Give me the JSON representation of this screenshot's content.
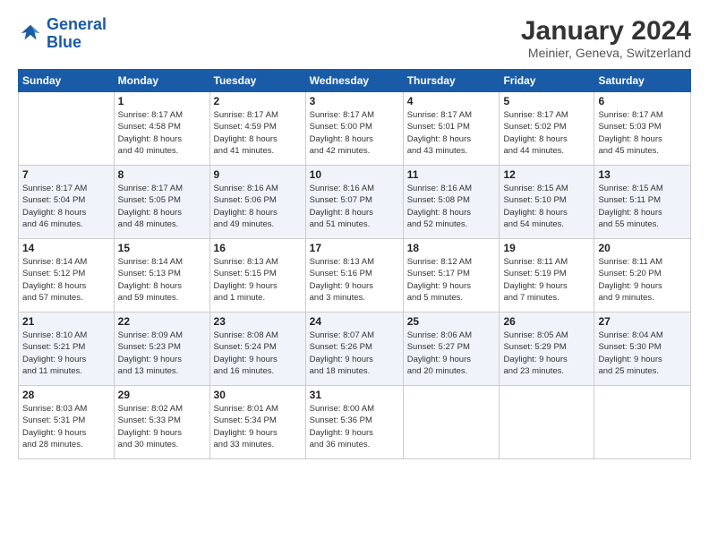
{
  "logo": {
    "line1": "General",
    "line2": "Blue"
  },
  "title": "January 2024",
  "subtitle": "Meinier, Geneva, Switzerland",
  "weekdays": [
    "Sunday",
    "Monday",
    "Tuesday",
    "Wednesday",
    "Thursday",
    "Friday",
    "Saturday"
  ],
  "weeks": [
    [
      {
        "day": "",
        "info": ""
      },
      {
        "day": "1",
        "info": "Sunrise: 8:17 AM\nSunset: 4:58 PM\nDaylight: 8 hours\nand 40 minutes."
      },
      {
        "day": "2",
        "info": "Sunrise: 8:17 AM\nSunset: 4:59 PM\nDaylight: 8 hours\nand 41 minutes."
      },
      {
        "day": "3",
        "info": "Sunrise: 8:17 AM\nSunset: 5:00 PM\nDaylight: 8 hours\nand 42 minutes."
      },
      {
        "day": "4",
        "info": "Sunrise: 8:17 AM\nSunset: 5:01 PM\nDaylight: 8 hours\nand 43 minutes."
      },
      {
        "day": "5",
        "info": "Sunrise: 8:17 AM\nSunset: 5:02 PM\nDaylight: 8 hours\nand 44 minutes."
      },
      {
        "day": "6",
        "info": "Sunrise: 8:17 AM\nSunset: 5:03 PM\nDaylight: 8 hours\nand 45 minutes."
      }
    ],
    [
      {
        "day": "7",
        "info": "Sunrise: 8:17 AM\nSunset: 5:04 PM\nDaylight: 8 hours\nand 46 minutes."
      },
      {
        "day": "8",
        "info": "Sunrise: 8:17 AM\nSunset: 5:05 PM\nDaylight: 8 hours\nand 48 minutes."
      },
      {
        "day": "9",
        "info": "Sunrise: 8:16 AM\nSunset: 5:06 PM\nDaylight: 8 hours\nand 49 minutes."
      },
      {
        "day": "10",
        "info": "Sunrise: 8:16 AM\nSunset: 5:07 PM\nDaylight: 8 hours\nand 51 minutes."
      },
      {
        "day": "11",
        "info": "Sunrise: 8:16 AM\nSunset: 5:08 PM\nDaylight: 8 hours\nand 52 minutes."
      },
      {
        "day": "12",
        "info": "Sunrise: 8:15 AM\nSunset: 5:10 PM\nDaylight: 8 hours\nand 54 minutes."
      },
      {
        "day": "13",
        "info": "Sunrise: 8:15 AM\nSunset: 5:11 PM\nDaylight: 8 hours\nand 55 minutes."
      }
    ],
    [
      {
        "day": "14",
        "info": "Sunrise: 8:14 AM\nSunset: 5:12 PM\nDaylight: 8 hours\nand 57 minutes."
      },
      {
        "day": "15",
        "info": "Sunrise: 8:14 AM\nSunset: 5:13 PM\nDaylight: 8 hours\nand 59 minutes."
      },
      {
        "day": "16",
        "info": "Sunrise: 8:13 AM\nSunset: 5:15 PM\nDaylight: 9 hours\nand 1 minute."
      },
      {
        "day": "17",
        "info": "Sunrise: 8:13 AM\nSunset: 5:16 PM\nDaylight: 9 hours\nand 3 minutes."
      },
      {
        "day": "18",
        "info": "Sunrise: 8:12 AM\nSunset: 5:17 PM\nDaylight: 9 hours\nand 5 minutes."
      },
      {
        "day": "19",
        "info": "Sunrise: 8:11 AM\nSunset: 5:19 PM\nDaylight: 9 hours\nand 7 minutes."
      },
      {
        "day": "20",
        "info": "Sunrise: 8:11 AM\nSunset: 5:20 PM\nDaylight: 9 hours\nand 9 minutes."
      }
    ],
    [
      {
        "day": "21",
        "info": "Sunrise: 8:10 AM\nSunset: 5:21 PM\nDaylight: 9 hours\nand 11 minutes."
      },
      {
        "day": "22",
        "info": "Sunrise: 8:09 AM\nSunset: 5:23 PM\nDaylight: 9 hours\nand 13 minutes."
      },
      {
        "day": "23",
        "info": "Sunrise: 8:08 AM\nSunset: 5:24 PM\nDaylight: 9 hours\nand 16 minutes."
      },
      {
        "day": "24",
        "info": "Sunrise: 8:07 AM\nSunset: 5:26 PM\nDaylight: 9 hours\nand 18 minutes."
      },
      {
        "day": "25",
        "info": "Sunrise: 8:06 AM\nSunset: 5:27 PM\nDaylight: 9 hours\nand 20 minutes."
      },
      {
        "day": "26",
        "info": "Sunrise: 8:05 AM\nSunset: 5:29 PM\nDaylight: 9 hours\nand 23 minutes."
      },
      {
        "day": "27",
        "info": "Sunrise: 8:04 AM\nSunset: 5:30 PM\nDaylight: 9 hours\nand 25 minutes."
      }
    ],
    [
      {
        "day": "28",
        "info": "Sunrise: 8:03 AM\nSunset: 5:31 PM\nDaylight: 9 hours\nand 28 minutes."
      },
      {
        "day": "29",
        "info": "Sunrise: 8:02 AM\nSunset: 5:33 PM\nDaylight: 9 hours\nand 30 minutes."
      },
      {
        "day": "30",
        "info": "Sunrise: 8:01 AM\nSunset: 5:34 PM\nDaylight: 9 hours\nand 33 minutes."
      },
      {
        "day": "31",
        "info": "Sunrise: 8:00 AM\nSunset: 5:36 PM\nDaylight: 9 hours\nand 36 minutes."
      },
      {
        "day": "",
        "info": ""
      },
      {
        "day": "",
        "info": ""
      },
      {
        "day": "",
        "info": ""
      }
    ]
  ]
}
